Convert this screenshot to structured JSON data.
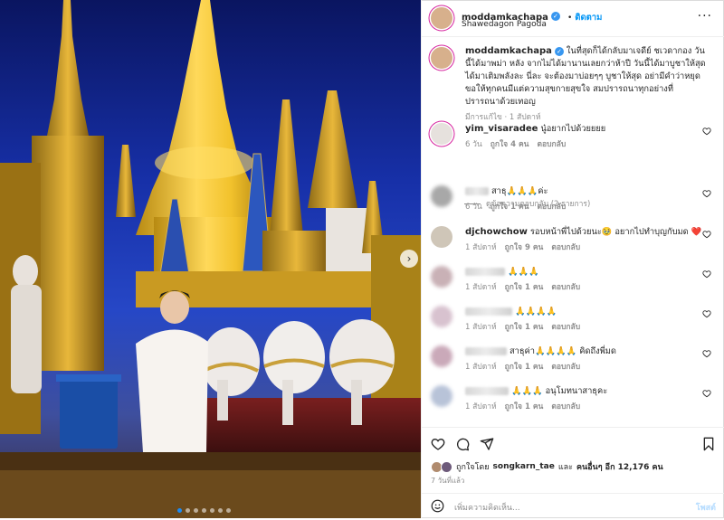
{
  "header": {
    "username": "moddamkachapa",
    "follow_label": "ติดตาม",
    "location": "Shawedagon Pagoda",
    "more_icon": "more-horizontal-icon"
  },
  "caption": {
    "username": "moddamkachapa",
    "text": "ในที่สุดก็ได้กลับมาเจดีย์ ชเวดากอง วันนี้ได้มาพม่า หลัง จากไม่ได้มานานเลยกว่าห้าปี วันนี้ได้มาบูชาให้สุดได้มาเติมพลังละ นี่ละ จะต้องมาบ่อยๆๆ บูชาให้สุด อย่ามีคำว่าหยุด ขอให้ทุกคนมีแต่ความสุขกายสุขใจ สมปรารถนาทุกอย่างที่ปรารถนาด้วยเทอญ",
    "meta": "มีการแก้ไข · 1 สัปดาห์"
  },
  "comments": [
    {
      "username": "yim_visaradee",
      "text": "นู๋อยากไปด้วยยยย",
      "time": "6 วัน",
      "likes": "ถูกใจ 4 คน",
      "reply": "ตอบกลับ"
    },
    {
      "text": "สาธุ🙏🙏🙏ค่ะ",
      "time": "6 วัน",
      "likes": "ถูกใจ 1 คน",
      "reply": "ตอบกลับ"
    },
    {
      "username": "djchowchow",
      "text": "รอบหน้าพี่ไปด้วยนะ🥹 อยากไปทำบุญกับมด ❤️",
      "time": "1 สัปดาห์",
      "likes": "ถูกใจ 9 คน",
      "reply": "ตอบกลับ"
    },
    {
      "text": "🙏🙏🙏",
      "time": "1 สัปดาห์",
      "likes": "ถูกใจ 1 คน",
      "reply": "ตอบกลับ"
    },
    {
      "text": "🙏🙏🙏🙏",
      "time": "1 สัปดาห์",
      "likes": "ถูกใจ 1 คน",
      "reply": "ตอบกลับ"
    },
    {
      "text": "สาธุค่า🙏🙏🙏🙏 คิดถึงพี่มด",
      "time": "1 สัปดาห์",
      "likes": "ถูกใจ 1 คน",
      "reply": "ตอบกลับ"
    },
    {
      "text": "🙏🙏🙏 อนุโมทนาสาธุคะ",
      "time": "1 สัปดาห์",
      "likes": "ถูกใจ 1 คน",
      "reply": "ตอบกลับ"
    }
  ],
  "view_replies": "ดูข้อความตอบกลับ (2 รายการ)",
  "actions": {
    "icons": [
      "heart-icon",
      "comment-icon",
      "share-icon",
      "bookmark-icon"
    ],
    "liked_prefix": "ถูกใจโดย",
    "liked_user": "songkarn_tae",
    "liked_mid": "และ",
    "liked_others": "คนอื่นๆ อีก 12,176 คน",
    "time": "7 วันที่แล้ว"
  },
  "add_comment": {
    "placeholder": "เพิ่มความคิดเห็น...",
    "post_label": "โพสต์"
  },
  "carousel": {
    "total": 7,
    "active_index": 0
  },
  "colors": {
    "accent": "#0095f6",
    "verified": "#3897f0",
    "like_red": "#ed4956"
  }
}
